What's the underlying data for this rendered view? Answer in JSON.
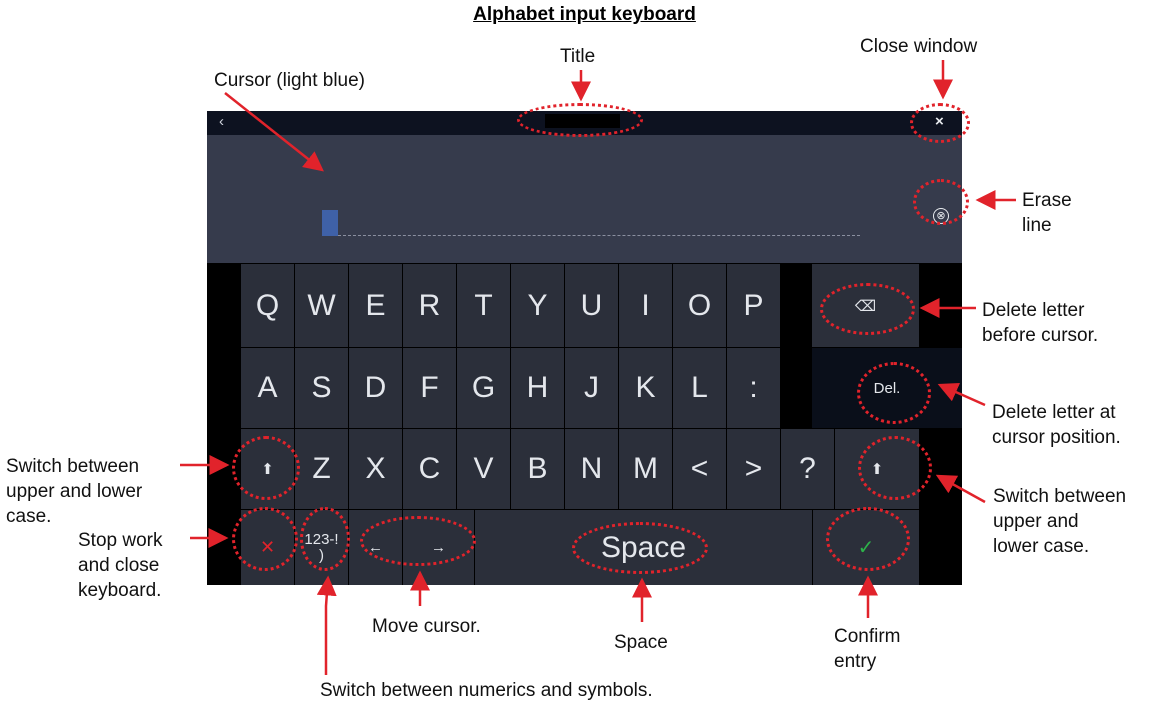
{
  "heading": "Alphabet input keyboard",
  "callouts": {
    "title": "Title",
    "close_window": "Close window",
    "cursor": "Cursor (light blue)",
    "erase_line": [
      "Erase",
      "line"
    ],
    "delete_before": [
      "Delete letter",
      "before cursor."
    ],
    "delete_at": [
      "Delete letter at",
      "cursor position."
    ],
    "switch_case_left": [
      "Switch between",
      "upper and lower",
      "case."
    ],
    "switch_case_right": [
      "Switch between",
      "upper and",
      "lower case."
    ],
    "stop_work": [
      "Stop work",
      "and close",
      "keyboard."
    ],
    "move_cursor": "Move cursor.",
    "space": "Space",
    "confirm": [
      "Confirm",
      "entry"
    ],
    "numerics": "Switch between numerics and symbols."
  },
  "keyboard": {
    "back_icon": "‹",
    "close_icon": "×",
    "erase_icon": "⊗",
    "row1": [
      "Q",
      "W",
      "E",
      "R",
      "T",
      "Y",
      "U",
      "I",
      "O",
      "P"
    ],
    "backspace_icon": "⌫",
    "row2": [
      "A",
      "S",
      "D",
      "F",
      "G",
      "H",
      "J",
      "K",
      "L",
      ":"
    ],
    "delete_label": "Del.",
    "row3": [
      "Z",
      "X",
      "C",
      "V",
      "B",
      "N",
      "M",
      "<",
      ">",
      "?"
    ],
    "shift_icon": "⬆",
    "cancel_icon": "✕",
    "numsym_label": "123-!\n)",
    "left_arrow": "←",
    "right_arrow": "→",
    "space_label": "Space",
    "confirm_icon": "✓"
  },
  "colors": {
    "cursor": "#3f61a8",
    "callout_red": "#e1232b",
    "cancel_red": "#e1232b",
    "confirm_green": "#2db34a"
  }
}
